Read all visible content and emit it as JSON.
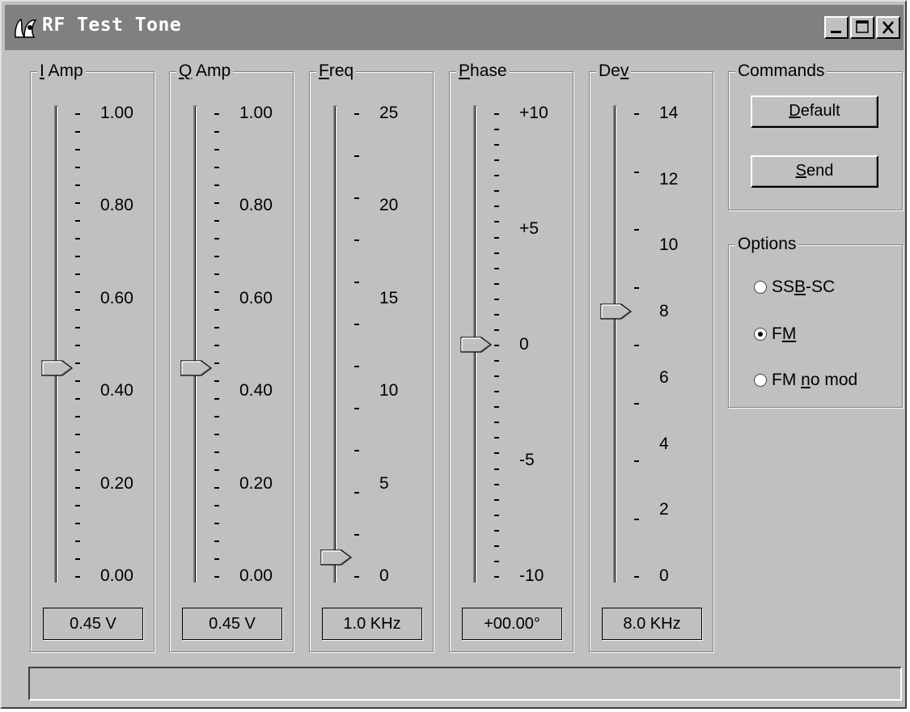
{
  "window": {
    "title": "RF Test Tone",
    "icon": "app-icon",
    "controls": [
      "minimize",
      "maximize",
      "close"
    ]
  },
  "sliders": [
    {
      "label": "I Amp",
      "label_pre": "",
      "label_mn": "I",
      "label_post": " Amp",
      "scale": [
        "1.00",
        "0.80",
        "0.60",
        "0.40",
        "0.20",
        "0.00"
      ],
      "minor_ticks": 26,
      "value_fraction": 0.45,
      "readout": "0.45 V"
    },
    {
      "label": "Q Amp",
      "label_pre": "",
      "label_mn": "Q",
      "label_post": " Amp",
      "scale": [
        "1.00",
        "0.80",
        "0.60",
        "0.40",
        "0.20",
        "0.00"
      ],
      "minor_ticks": 26,
      "value_fraction": 0.45,
      "readout": "0.45 V"
    },
    {
      "label": "Freq",
      "label_pre": "",
      "label_mn": "F",
      "label_post": "req",
      "scale": [
        "25",
        "20",
        "15",
        "10",
        "5",
        "0"
      ],
      "minor_ticks": 11,
      "value_fraction": 0.04,
      "readout": "1.0 KHz"
    },
    {
      "label": "Phase",
      "label_pre": "",
      "label_mn": "P",
      "label_post": "hase",
      "scale": [
        "+10",
        "+5",
        "0",
        "-5",
        "-10"
      ],
      "minor_ticks": 30,
      "value_fraction": 0.5,
      "readout": "+00.00°"
    },
    {
      "label": "Dev",
      "label_pre": "De",
      "label_mn": "v",
      "label_post": "",
      "scale": [
        "14",
        "12",
        "10",
        "8",
        "6",
        "4",
        "2",
        "0"
      ],
      "minor_ticks": 8,
      "value_fraction": 0.5714,
      "readout": "8.0 KHz"
    }
  ],
  "commands": {
    "label": "Commands",
    "default_pre": "",
    "default_mn": "D",
    "default_post": "efault",
    "send_pre": "",
    "send_mn": "S",
    "send_post": "end"
  },
  "options": {
    "label": "Options",
    "items": [
      {
        "pre": "SS",
        "mn": "B",
        "post": "-SC",
        "checked": false
      },
      {
        "pre": "F",
        "mn": "M",
        "post": "",
        "checked": true
      },
      {
        "pre": "FM ",
        "mn": "n",
        "post": "o mod",
        "checked": false
      }
    ]
  },
  "status_text": ""
}
